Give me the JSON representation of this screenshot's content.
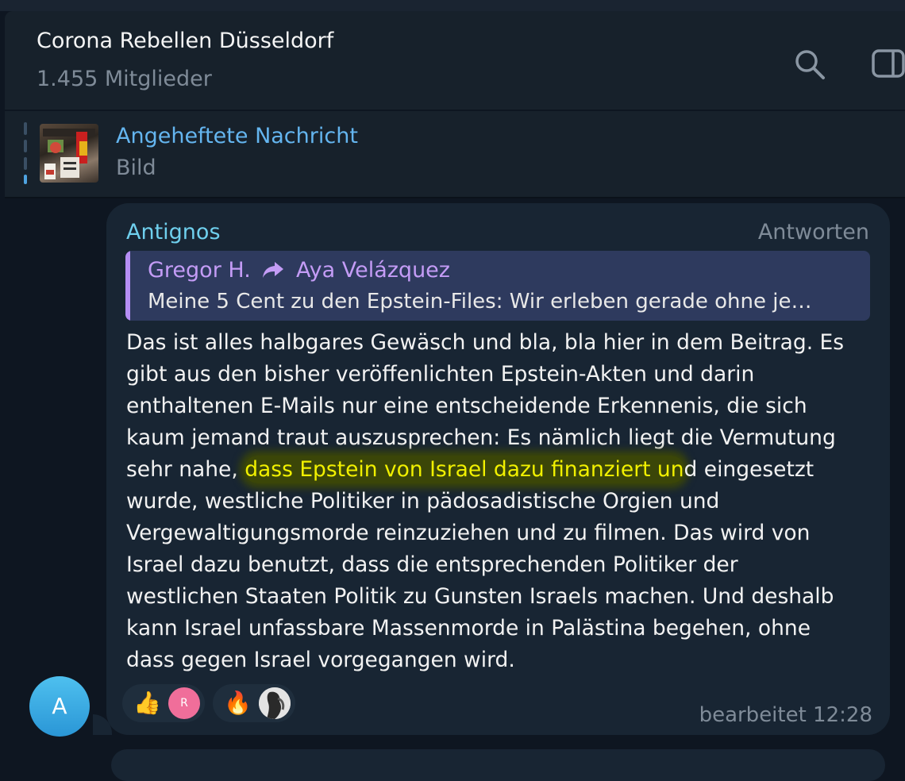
{
  "header": {
    "title": "Corona Rebellen Düsseldorf",
    "members": "1.455 Mitglieder",
    "search_icon": "search-icon",
    "panel_icon": "sidebar-toggle-icon"
  },
  "pinned": {
    "title": "Angeheftete Nachricht",
    "subtitle": "Bild"
  },
  "message": {
    "author": "Antignos",
    "reply_label": "Antworten",
    "quote": {
      "from": "Gregor H.",
      "forwarded_from": "Aya Velázquez",
      "text": "Meine 5 Cent zu den Epstein-Files: Wir erleben gerade ohne je…"
    },
    "text_before": "Das ist alles halbgares Gewäsch und bla, bla hier in dem Beitrag. Es\ngibt aus den bisher veröffenlichten Epstein-Akten und darin\nenthaltenen E-Mails nur eine entscheidende Erkennenis, die sich\nkaum jemand traut auszusprechen: Es nämlich liegt die Vermutung\nsehr nahe, ",
    "text_highlight": "dass Epstein von Israel dazu finanziert un",
    "text_after": "d eingesetzt\nwurde, westliche Politiker in pädosadistische Orgien und\nVergewaltigungsmorde reinzuziehen und zu filmen. Das wird von\nIsrael dazu benutzt, dass die entsprechenden Politiker der\nwestlichen Staaten Politik zu Gunsten Israels machen. Und deshalb\nkann Israel unfassbare Massenmorde in Palästina begehen, ohne\ndass gegen Israel vorgegangen wird.",
    "reactions": [
      {
        "emoji": "👍",
        "avatar_letter": "R",
        "avatar_color": "#f06e9a"
      },
      {
        "emoji": "🔥",
        "avatar_letter": "",
        "avatar_color": "#d8d8d8"
      }
    ],
    "meta": "bearbeitet 12:28",
    "sender_avatar_letter": "A"
  },
  "colors": {
    "background": "#0e1621",
    "panel": "#17212b",
    "bubble": "#182533",
    "author": "#6fd0ee",
    "link": "#64b5ef",
    "quote_accent": "#b58ef5",
    "highlight_text": "#f1f000",
    "highlight_bg": "#3b4608"
  }
}
